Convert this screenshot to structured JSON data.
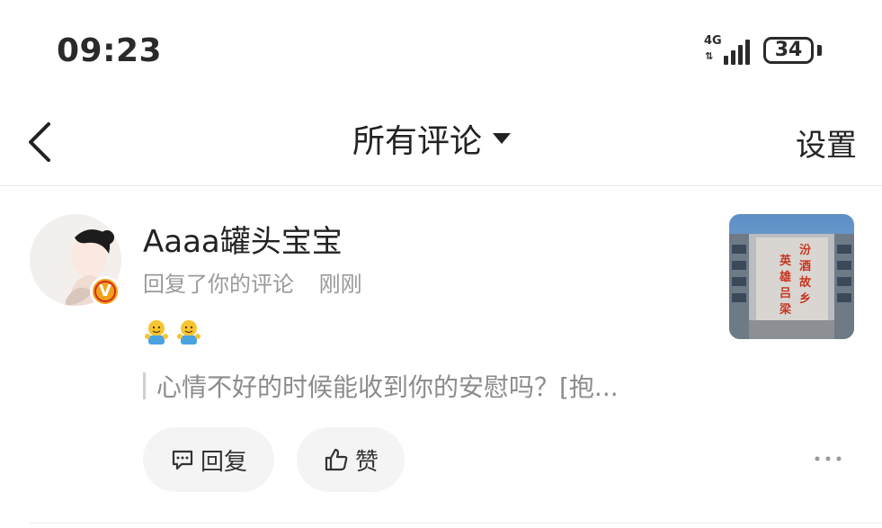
{
  "status_bar": {
    "time": "09:23",
    "network": "4G",
    "network_arrows": "⇅",
    "battery": "34"
  },
  "nav": {
    "title": "所有评论",
    "settings_label": "设置"
  },
  "comment": {
    "username": "Aaaa罐头宝宝",
    "action": "回复了你的评论",
    "time_ago": "刚刚",
    "verified_badge": "V",
    "emoji": [
      "hug-emoji",
      "hug-emoji"
    ],
    "quoted_text": "心情不好的时候能收到你的安慰吗？[抱...",
    "reply_label": "回复",
    "like_label": "赞",
    "thumbnail_text": "汾酒故乡 英雄吕梁"
  },
  "colors": {
    "text_primary": "#222222",
    "text_secondary": "#9a9a9a",
    "button_bg": "#f4f4f4",
    "badge_gold": "#f0a31a",
    "badge_red": "#d9271c"
  }
}
